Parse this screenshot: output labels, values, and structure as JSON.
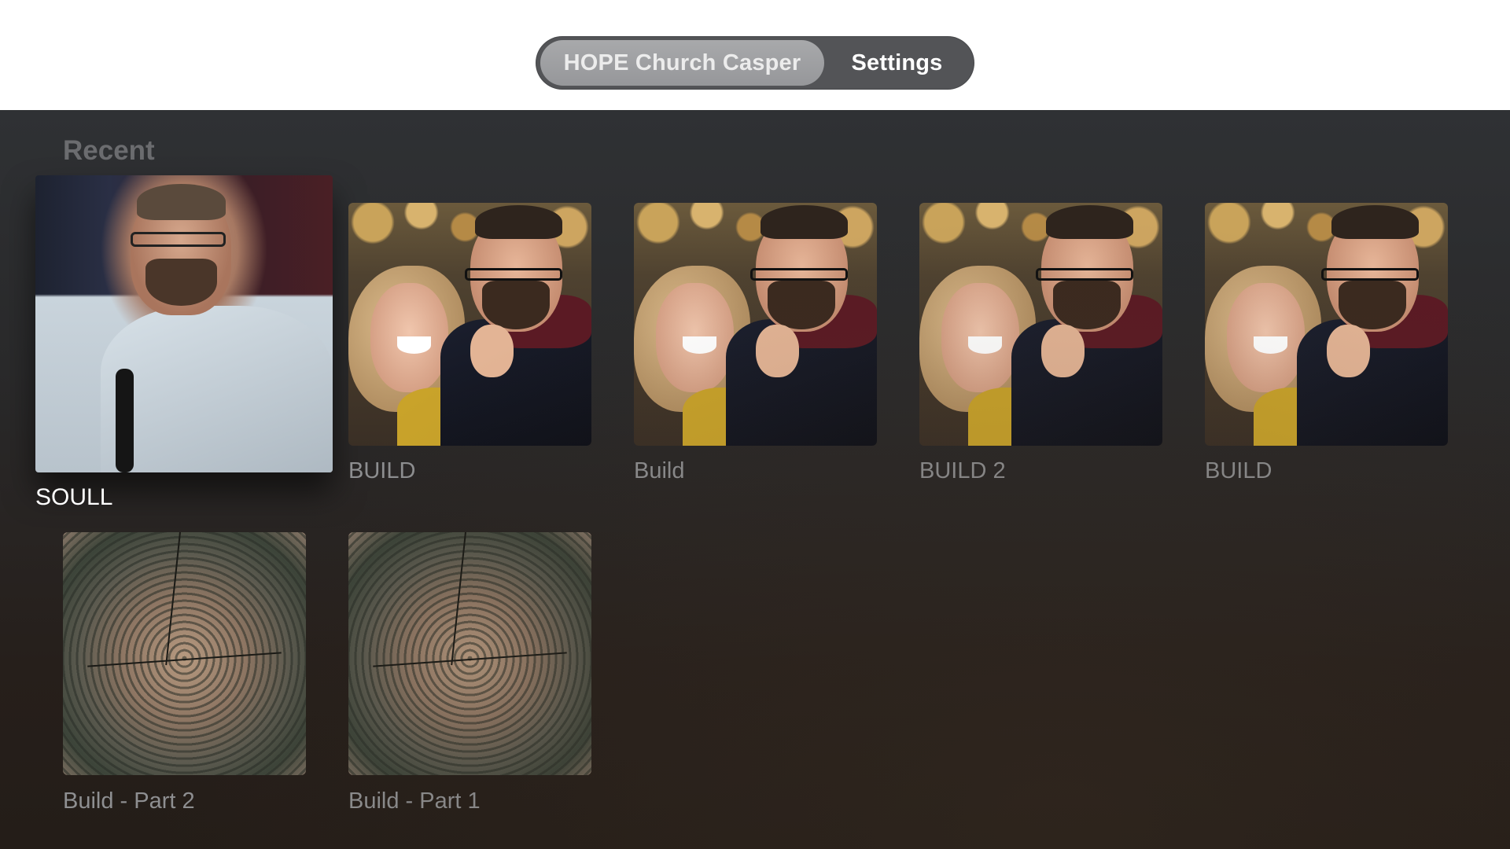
{
  "topbar": {
    "tabs": [
      {
        "label": "HOPE Church Casper",
        "selected": true
      },
      {
        "label": "Settings",
        "selected": false
      }
    ]
  },
  "section": {
    "title": "Recent"
  },
  "items": [
    {
      "title": "SOULL",
      "artwork": "speaker-with-microphone",
      "focused": true
    },
    {
      "title": "BUILD",
      "artwork": "couple-laughing"
    },
    {
      "title": "Build",
      "artwork": "couple-laughing"
    },
    {
      "title": "BUILD 2",
      "artwork": "couple-laughing"
    },
    {
      "title": "BUILD",
      "artwork": "couple-laughing"
    },
    {
      "title": "Build - Part 2",
      "artwork": "wood-tree-rings"
    },
    {
      "title": "Build - Part 1",
      "artwork": "wood-tree-rings"
    }
  ],
  "colors": {
    "tab_selected_bg": "#9fa0a2",
    "tab_bar_bg": "#535457",
    "content_bg": "#2b2b2c",
    "label_color": "#8e8f91",
    "focused_label_color": "#ffffff"
  }
}
